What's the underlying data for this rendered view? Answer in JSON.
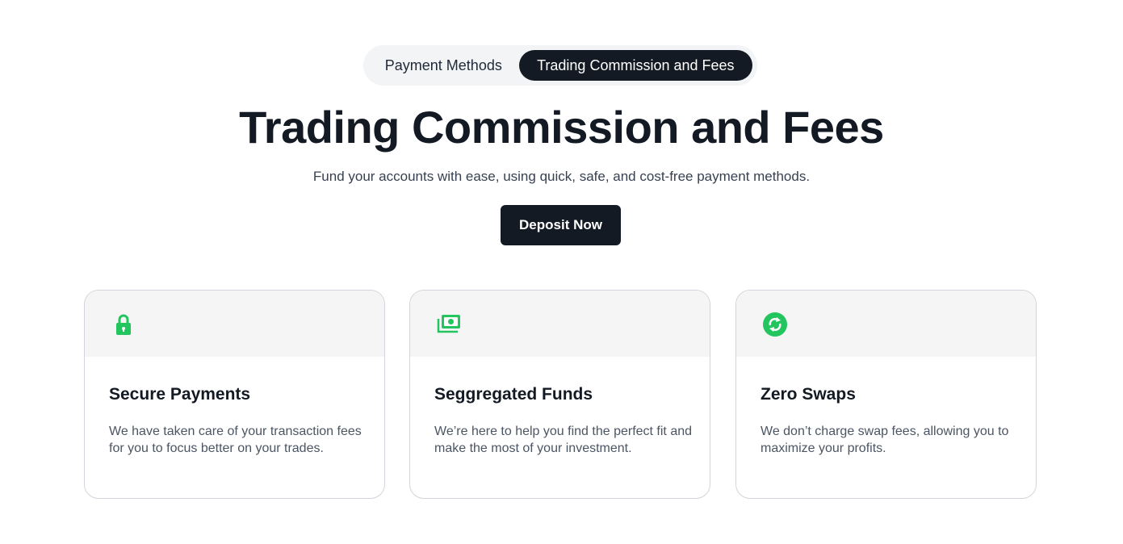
{
  "tabs": [
    {
      "label": "Payment Methods",
      "active": false
    },
    {
      "label": "Trading Commission and Fees",
      "active": true
    }
  ],
  "hero": {
    "title": "Trading Commission and Fees",
    "subtitle": "Fund your accounts with ease, using quick, safe, and cost-free payment methods.",
    "cta_label": "Deposit Now"
  },
  "cards": [
    {
      "icon": "lock-icon",
      "title": "Secure Payments",
      "description": "We have taken care of your transaction fees for you to focus better on your trades."
    },
    {
      "icon": "money-icon",
      "title": "Seggregated Funds",
      "description": "We’re here to help you find the perfect fit and make the most of your investment."
    },
    {
      "icon": "exchange-icon",
      "title": "Zero Swaps",
      "description": "We don’t charge swap fees, allowing you to maximize your profits."
    }
  ],
  "colors": {
    "accent": "#22c55e",
    "dark": "#131a24",
    "card_header": "#f5f5f5"
  }
}
